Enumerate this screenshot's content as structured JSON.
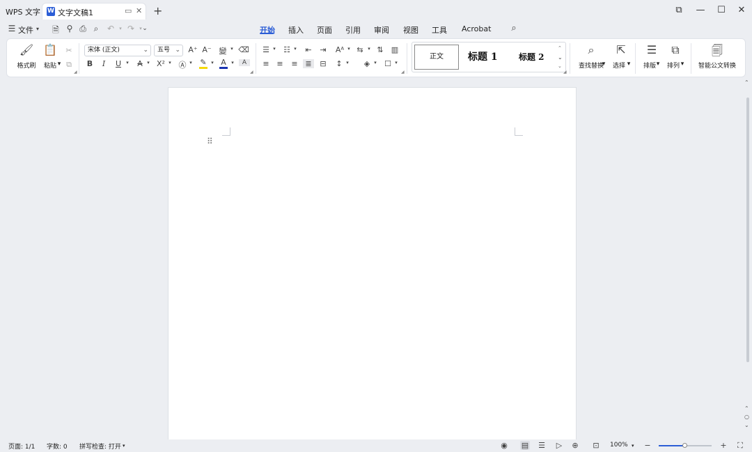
{
  "titlebar": {
    "app_name": "WPS 文字",
    "doc_tab": {
      "title": "文字文稿1"
    },
    "new_tab": "+"
  },
  "menurow": {
    "file_menu": "文件",
    "tabs": [
      "开始",
      "插入",
      "页面",
      "引用",
      "审阅",
      "视图",
      "工具",
      "Acrobat"
    ],
    "active_tab": "开始"
  },
  "ribbon": {
    "format_painter": "格式刷",
    "paste": "粘贴",
    "font_name": "宋体 (正文)",
    "font_size": "五号",
    "styles": {
      "normal": "正文",
      "heading1": "标题 1",
      "heading2": "标题 2"
    },
    "find_replace": "查找替换",
    "select": "选择",
    "layout": "排版",
    "arrange": "排列",
    "smart_convert": "智能公文转换"
  },
  "statusbar": {
    "page": "页面: 1/1",
    "word_count": "字数: 0",
    "spell_check": "拼写检查: 打开",
    "zoom": "100%",
    "zoom_level": 0.5
  },
  "colors": {
    "accent": "#2b5dd6",
    "highlight": "#f5d90a",
    "font_color": "#1a33b0"
  }
}
